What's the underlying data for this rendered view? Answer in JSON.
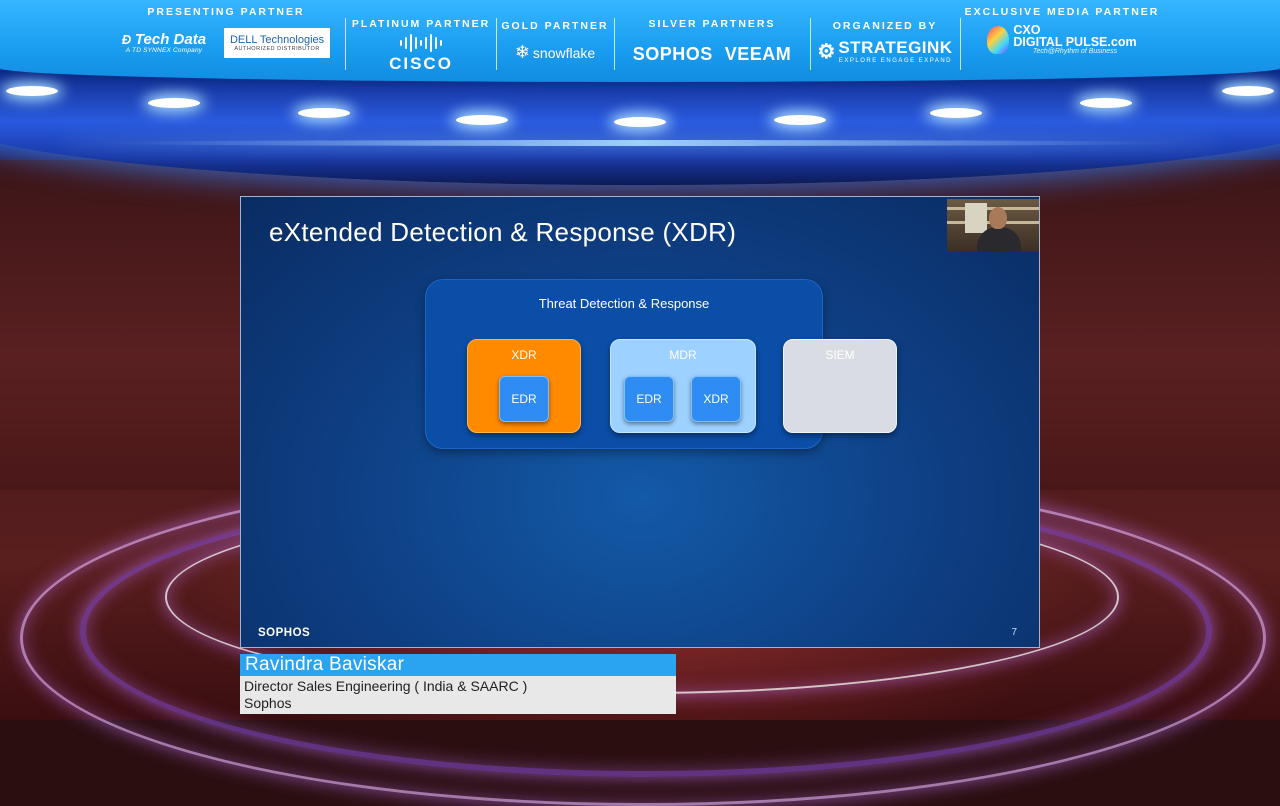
{
  "banner": {
    "presenting": {
      "title": "PRESENTING PARTNER",
      "techdata": "Tech Data",
      "techdata_sub": "A TD SYNNEX Company",
      "dell_main": "DELL Technologies",
      "dell_sub": "AUTHORIZED DISTRIBUTOR"
    },
    "platinum": {
      "title": "PLATINUM PARTNER",
      "logo": "CISCO"
    },
    "gold": {
      "title": "GOLD PARTNER",
      "logo": "snowflake"
    },
    "silver": {
      "title": "SILVER PARTNERS",
      "logo1": "SOPHOS",
      "logo2": "VEEAM"
    },
    "organizer": {
      "title": "ORGANIZED BY",
      "logo": "STRATEGINK",
      "tagline": "EXPLORE ENGAGE EXPAND"
    },
    "media": {
      "title": "EXCLUSIVE MEDIA PARTNER",
      "logo_line1": "CXO",
      "logo_line2": "DIGITAL PULSE.com",
      "tagline": "Tech@Rhythm of Business"
    }
  },
  "slide": {
    "title": "eXtended Detection & Response (XDR)",
    "group_label": "Threat Detection & Response",
    "boxes": {
      "xdr": {
        "label": "XDR",
        "inner": [
          "EDR"
        ]
      },
      "mdr": {
        "label": "MDR",
        "inner": [
          "EDR",
          "XDR"
        ]
      },
      "siem": {
        "label": "SIEM"
      }
    },
    "footer_logo": "SOPHOS",
    "page_number": "7"
  },
  "speaker": {
    "name": "Ravindra Baviskar",
    "title": "Director Sales Engineering ( India & SAARC )",
    "company": "Sophos"
  },
  "colors": {
    "banner": "#1a9df0",
    "xdr_orange": "#ff8a00",
    "mdr_light_blue": "#9dd1ff",
    "siem_gray": "#d9dde3",
    "group_blue": "#0b4ea8",
    "name_bar": "#2aa3f0"
  }
}
